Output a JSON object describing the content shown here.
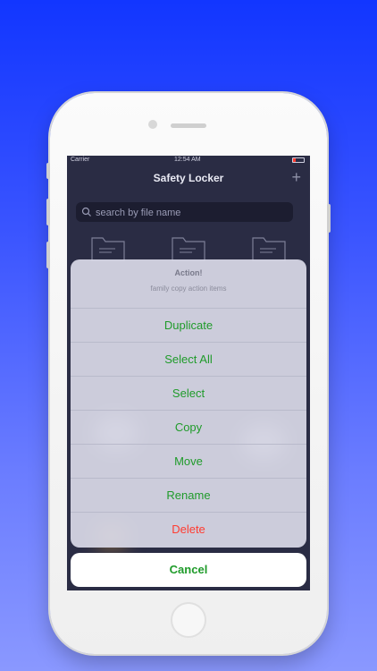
{
  "status_bar": {
    "carrier": "Carrier",
    "time": "12:54 AM"
  },
  "navbar": {
    "title": "Safety Locker",
    "add_icon": "plus-icon"
  },
  "search": {
    "placeholder": "search by file name",
    "icon": "search-icon"
  },
  "folders": [
    {
      "icon": "folder-icon"
    },
    {
      "icon": "folder-icon"
    },
    {
      "icon": "folder-icon"
    }
  ],
  "action_sheet": {
    "title": "Action!",
    "message": "family copy  action items",
    "actions": [
      {
        "label": "Duplicate"
      },
      {
        "label": "Select All"
      },
      {
        "label": "Select"
      },
      {
        "label": "Copy"
      },
      {
        "label": "Move"
      },
      {
        "label": "Rename"
      },
      {
        "label": "Delete"
      }
    ],
    "cancel_label": "Cancel"
  },
  "colors": {
    "background_top": "#1236ff",
    "background_bottom": "#8a98ff",
    "screen_bg": "#2a2c44",
    "action_green": "#1f9b2a",
    "destructive_red": "#ff3b30"
  }
}
